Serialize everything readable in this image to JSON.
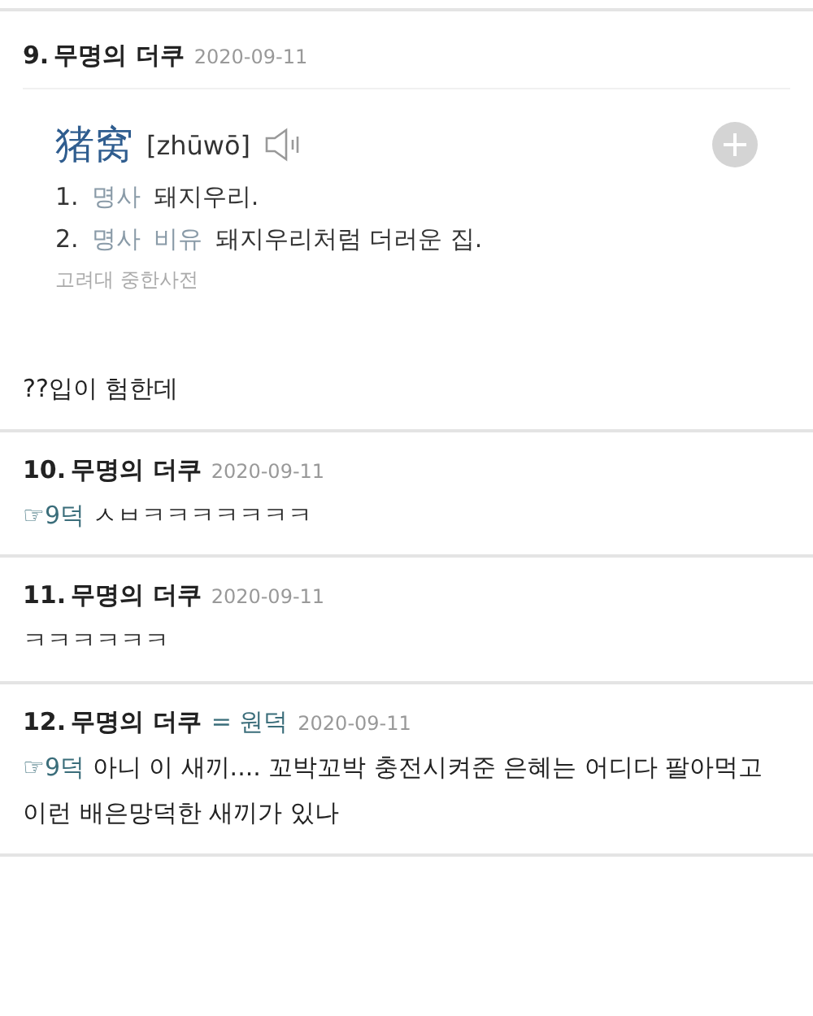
{
  "comments": [
    {
      "number": "9.",
      "author": "무명의 더쿠",
      "date": "2020-09-11",
      "dictionary": {
        "headword": "猪窝",
        "pinyin": "[zhūwō]",
        "senses": [
          {
            "number": "1.",
            "tags": [
              "명사"
            ],
            "text": "돼지우리."
          },
          {
            "number": "2.",
            "tags": [
              "명사",
              "비유"
            ],
            "text": "돼지우리처럼 더러운 집."
          }
        ],
        "source": "고려대 중한사전"
      },
      "body": "??입이 험한데"
    },
    {
      "number": "10.",
      "author": "무명의 더쿠",
      "date": "2020-09-11",
      "reply_to": "☞9덕",
      "body": "ㅅㅂㅋㅋㅋㅋㅋㅋㅋ"
    },
    {
      "number": "11.",
      "author": "무명의 더쿠",
      "date": "2020-09-11",
      "body": "ㅋㅋㅋㅋㅋㅋ"
    },
    {
      "number": "12.",
      "author": "무명의 더쿠",
      "author_note": "= 원덕",
      "date": "2020-09-11",
      "reply_to": "☞9덕",
      "body": "아니 이 새끼.... 꼬박꼬박 충전시켜준 은혜는 어디다 팔아먹고 이런 배은망덕한 새끼가 있나"
    }
  ]
}
